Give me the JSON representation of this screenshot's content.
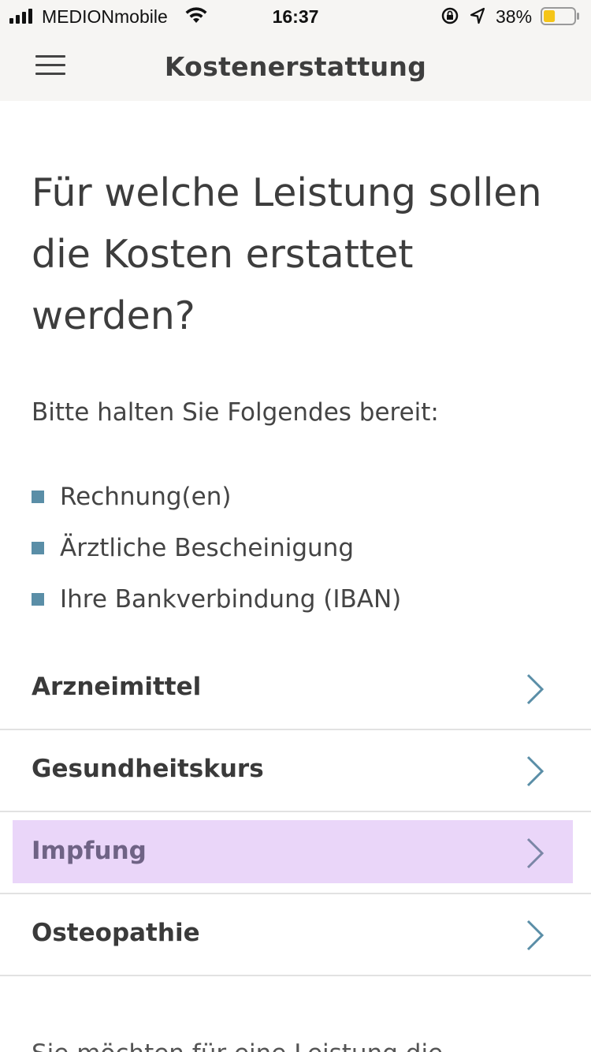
{
  "status_bar": {
    "carrier": "MEDIONmobile",
    "time": "16:37",
    "battery_percent": "38%",
    "battery_level": 0.38,
    "battery_color": "#f5c518",
    "icons": [
      "signal-icon",
      "wifi-icon",
      "rotation-lock-icon",
      "location-icon",
      "battery-icon"
    ]
  },
  "navbar": {
    "title": "Kostenerstattung",
    "menu_icon": "hamburger-menu-icon"
  },
  "content": {
    "heading": "Für welche Leistung sollen die Kosten erstattet werden?",
    "subtext": "Bitte halten Sie Folgendes bereit:",
    "bullets": [
      "Rechnung(en)",
      "Ärztliche Bescheinigung",
      "Ihre Bankverbindung (IBAN)"
    ],
    "bullet_color": "#5a8ea7"
  },
  "options": [
    {
      "label": "Arzneimittel"
    },
    {
      "label": "Gesundheitskurs"
    },
    {
      "label": "Impfung"
    },
    {
      "label": "Osteopathie"
    }
  ],
  "highlight_color": "#ead6f9",
  "chevron_color": "#5a8ea7",
  "footer_text": "Sie möchten für eine Leistung die"
}
